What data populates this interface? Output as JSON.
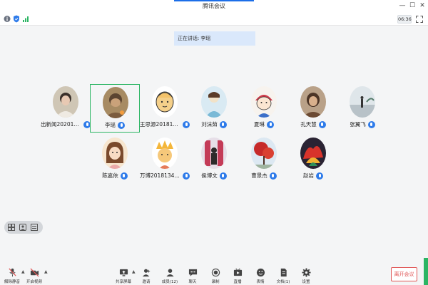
{
  "window": {
    "title": "腾讯会议",
    "minimize": "—",
    "maximize": "☐",
    "close": "✕"
  },
  "toolbar": {
    "time": "06:36"
  },
  "speaking": {
    "label": "正在讲话:",
    "name": "李瑶"
  },
  "participants": [
    {
      "name": "出新闻2020131...",
      "active": false
    },
    {
      "name": "李瑶",
      "active": true
    },
    {
      "name": "王思源2018134...",
      "active": false
    },
    {
      "name": "刘沫茹",
      "active": false
    },
    {
      "name": "夏琳",
      "active": false
    },
    {
      "name": "孔天慧",
      "active": false
    },
    {
      "name": "张翼飞",
      "active": false
    },
    {
      "name": "陈嘉依",
      "active": false
    },
    {
      "name": "万博2018134121",
      "active": false
    },
    {
      "name": "侯博文",
      "active": false
    },
    {
      "name": "曹景杰",
      "active": false
    },
    {
      "name": "赵岩",
      "active": false
    }
  ],
  "bottombar": {
    "unmute": "解除静音",
    "start_video": "开启视频",
    "share_screen": "共享屏幕",
    "invite": "邀请",
    "members": "成员(12)",
    "chat": "聊天",
    "record": "录制",
    "live": "直播",
    "reactions": "表情",
    "docs": "文档(1)",
    "settings": "设置",
    "leave": "离开会议"
  },
  "colors": {
    "accent": "#1c6ee8",
    "active_border": "#2bb563",
    "leave": "#e05454",
    "mic_badge": "#2e7bea"
  }
}
